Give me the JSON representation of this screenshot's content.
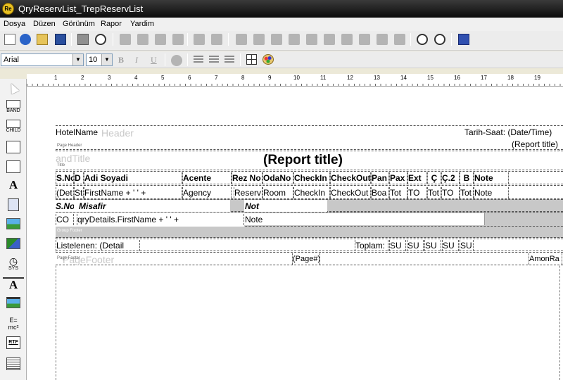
{
  "window": {
    "title": "QryReservList_TrepReservList",
    "app_icon_label": "Re"
  },
  "menu": [
    "Dosya",
    "Düzen",
    "Görünüm",
    "Rapor",
    "Yardim"
  ],
  "format_bar": {
    "font_name": "Arial",
    "font_size": "10",
    "bold_label": "B",
    "italic_label": "I",
    "underline_label": "U"
  },
  "toolbox": {
    "band_label": "BAND",
    "child_label": "CHILD",
    "sys_label": "SYS",
    "expr_label": "E=\nmc²",
    "rtf_label": "RTF"
  },
  "ruler": [
    "1",
    "2",
    "3",
    "4",
    "5",
    "6",
    "7",
    "8",
    "9",
    "10",
    "11",
    "12",
    "13",
    "14",
    "15",
    "16",
    "17",
    "18",
    "19"
  ],
  "report": {
    "page_header": {
      "label": "Page Header",
      "ghost": "Header",
      "hotel_name": "HotelName",
      "date_time": "Tarih-Saat: (Date/Time)",
      "report_title_small": "(Report title)"
    },
    "title_band": {
      "label": "Title",
      "ghost": "andTitle",
      "report_title": "(Report title)"
    },
    "column_headers": [
      "S.No",
      "D",
      "Adi Soyadi",
      "Acente",
      "Rez No",
      "OdaNo",
      "CheckIn",
      "CheckOut",
      "Pan",
      "Pax",
      "Ext",
      "Ç",
      "Ç.2",
      "B",
      "Note"
    ],
    "detail_fields": [
      "(Det",
      "St",
      "FirstName + ' ' +",
      "Agency",
      "Reserv",
      "Room",
      "CheckIn",
      "CheckOut",
      "Boa",
      "Tot",
      "TO",
      "Tot",
      "TO",
      "Tot",
      "Note"
    ],
    "sub_header": {
      "sno": "S.No",
      "misafir": "Misafir",
      "not": "Not"
    },
    "sub_detail": {
      "co": "CO",
      "first_name": "qryDetails.FirstName + ' ' +",
      "note": "Note"
    },
    "group_footer": {
      "label": "Group Footer"
    },
    "summary": {
      "listelenen": "Listelenen: (Detail",
      "toplam": "Toplam:",
      "su": [
        "SU",
        "SU",
        "SU",
        "SU",
        "SU"
      ]
    },
    "page_footer": {
      "label": "Page Footer",
      "ghost": "PageFooter",
      "page_num": "(Page#)",
      "amonra": "AmonRa"
    }
  }
}
